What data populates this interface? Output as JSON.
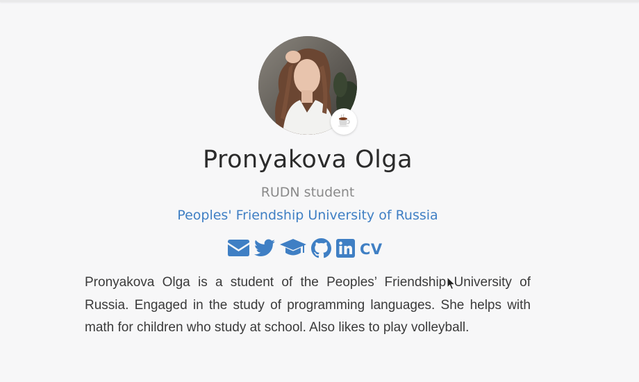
{
  "profile": {
    "name": "Pronyakova Olga",
    "role": "RUDN student",
    "organization": "Peoples' Friendship University of Russia",
    "avatar_badge": "☕",
    "bio": "Pronyakova Olga is a student of the Peoples’ Friendship University of Russia. Engaged in the study of programming languages. She helps with math for children who study at school. Also likes to play volleyball."
  },
  "social": {
    "links": [
      {
        "icon": "envelope-icon"
      },
      {
        "icon": "twitter-icon"
      },
      {
        "icon": "graduation-cap-icon"
      },
      {
        "icon": "github-icon"
      },
      {
        "icon": "linkedin-icon"
      },
      {
        "label": "CV"
      }
    ]
  },
  "colors": {
    "accent": "#3f7fc4",
    "background": "#f7f7f8",
    "text": "#3a3a3a",
    "muted": "#8a8a8a"
  }
}
